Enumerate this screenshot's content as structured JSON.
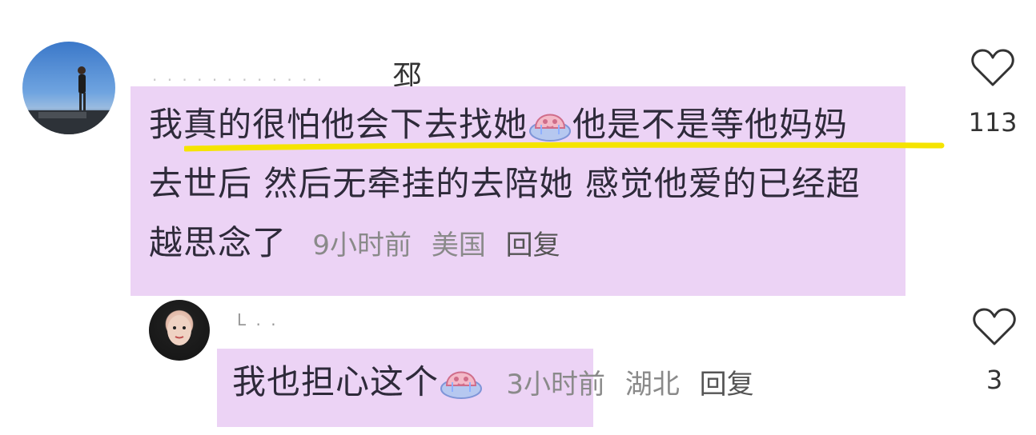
{
  "comments": [
    {
      "username": "邳",
      "text_line1": "我真的很怕他会下去找她",
      "text_line1b": "他是不是等他妈妈",
      "text_line2": "去世后 然后无牵挂的去陪她 感觉他爱的已经超",
      "text_line3": "越思念了",
      "time": "9小时前",
      "location": "美国",
      "reply_label": "回复",
      "likes": "113"
    },
    {
      "username": "L . .",
      "text": "我也担心这个",
      "time": "3小时前",
      "location": "湖北",
      "reply_label": "回复",
      "likes": "3"
    }
  ],
  "icons": {
    "like": "heart-outline-icon",
    "sticker": "crying-blob-sticker-icon"
  },
  "colors": {
    "highlight": "#ecd3f5",
    "underline": "#f5e400",
    "meta_text": "#8a8a8a"
  }
}
